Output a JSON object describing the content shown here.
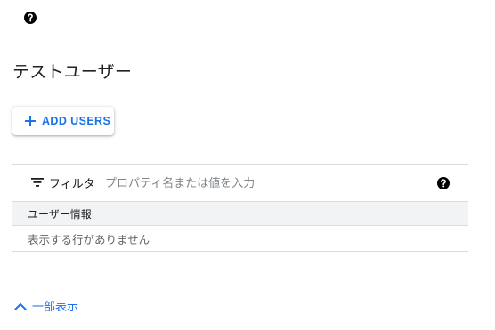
{
  "page": {
    "title": "テストユーザー"
  },
  "toolbar": {
    "add_users_label": "ADD USERS"
  },
  "filter": {
    "label": "フィルタ",
    "placeholder": "プロパティ名または値を入力"
  },
  "table": {
    "columns": [
      "ユーザー情報"
    ],
    "empty_message": "表示する行がありません"
  },
  "footer": {
    "toggle_label": "一部表示"
  },
  "icons": {
    "help": "help-circle-icon",
    "add": "plus-icon",
    "filter": "filter-list-icon",
    "collapse": "chevron-up-icon"
  },
  "colors": {
    "accent": "#1a73e8",
    "text": "#202124",
    "muted": "#5f6368",
    "divider": "#dadce0",
    "header_bg": "#f1f3f4"
  }
}
